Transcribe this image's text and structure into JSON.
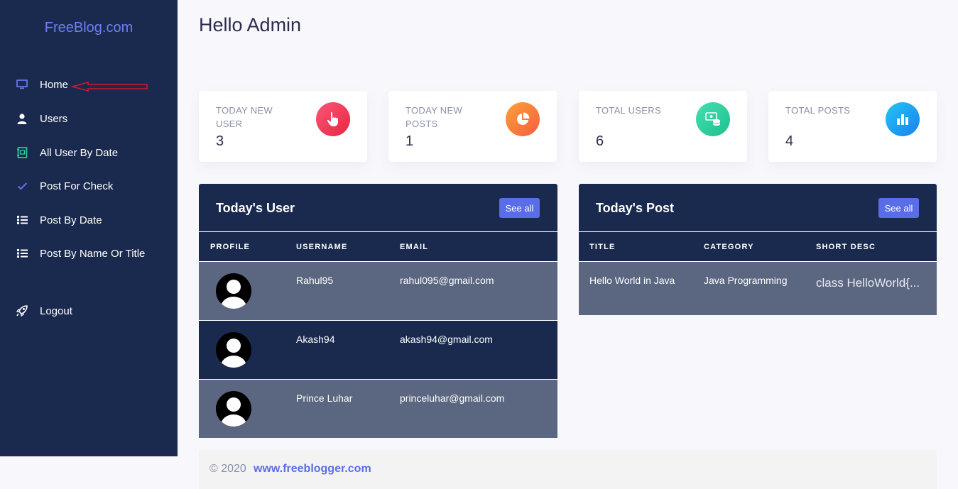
{
  "brand": "FreeBlog.com",
  "sidebar": {
    "items": [
      {
        "label": "Home",
        "icon": "monitor-icon"
      },
      {
        "label": "Users",
        "icon": "user-icon"
      },
      {
        "label": "All User By Date",
        "icon": "address-book-icon"
      },
      {
        "label": "Post For Check",
        "icon": "check-icon"
      },
      {
        "label": "Post By Date",
        "icon": "list-icon"
      },
      {
        "label": "Post By Name Or Title",
        "icon": "list-icon"
      },
      {
        "label": "Logout",
        "icon": "rocket-icon"
      }
    ]
  },
  "header": {
    "title": "Hello Admin"
  },
  "cards": [
    {
      "label": "TODAY NEW USER",
      "value": "3",
      "icon": "pointer-hand-icon",
      "color_from": "#f44a6a",
      "color_to": "#e8273f"
    },
    {
      "label": "TODAY NEW POSTS",
      "value": "1",
      "icon": "pie-chart-icon",
      "color_from": "#fb9a3c",
      "color_to": "#f55e3f"
    },
    {
      "label": "TOTAL USERS",
      "value": "6",
      "icon": "money-stack-icon",
      "color_from": "#3ed9a8",
      "color_to": "#1fbf8f"
    },
    {
      "label": "TOTAL POSTS",
      "value": "4",
      "icon": "bar-chart-icon",
      "color_from": "#22c0f5",
      "color_to": "#1a7ff0"
    }
  ],
  "users_panel": {
    "title": "Today's User",
    "see_all": "See all",
    "columns": [
      "PROFILE",
      "USERNAME",
      "EMAIL"
    ],
    "rows": [
      {
        "username": "Rahul95",
        "email": "rahul095@gmail.com"
      },
      {
        "username": "Akash94",
        "email": "akash94@gmail.com"
      },
      {
        "username": "Prince Luhar",
        "email": "princeluhar@gmail.com"
      }
    ]
  },
  "posts_panel": {
    "title": "Today's Post",
    "see_all": "See all",
    "columns": [
      "TITLE",
      "CATEGORY",
      "SHORT DESC"
    ],
    "rows": [
      {
        "title": "Hello World in Java",
        "category": "Java Programming",
        "short_desc": "class HelloWorld{..."
      }
    ]
  },
  "footer": {
    "copyright": "© 2020",
    "link": "www.freeblogger.com"
  },
  "colors": {
    "sidebar_bg": "#1a2a4f",
    "accent": "#5a6de8",
    "row_alt": "#5b6780"
  }
}
